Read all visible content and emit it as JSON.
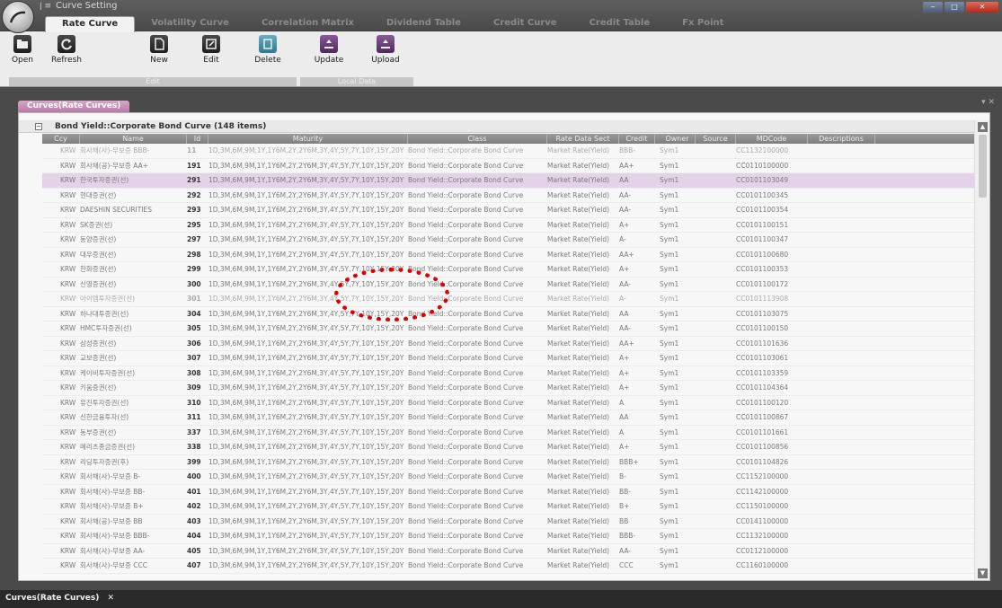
{
  "window": {
    "title": "Curve Setting",
    "qat": "ǀ  ≡",
    "controls": [
      "‒",
      "□",
      "✕"
    ]
  },
  "tabs": [
    "Rate Curve",
    "Volatility Curve",
    "Correlation Matrix",
    "Dividend Table",
    "Credit Curve",
    "Credit Table",
    "Fx Point"
  ],
  "ribbon": {
    "buttons": [
      {
        "label": "Open",
        "icon": "folder-icon"
      },
      {
        "label": "Refresh",
        "icon": "refresh-icon"
      },
      {
        "label": "New",
        "icon": "new-document-icon"
      },
      {
        "label": "Edit",
        "icon": "edit-icon"
      },
      {
        "label": "Delete",
        "icon": "delete-icon"
      },
      {
        "label": "Update",
        "icon": "update-icon"
      },
      {
        "label": "Upload",
        "icon": "upload-icon"
      }
    ],
    "groups": [
      "Edit",
      "Local Data"
    ]
  },
  "document_tab": "Curves(Rate Curves)",
  "group_title": "Bond Yield::Corporate Bond Curve (148 items)",
  "columns": [
    "Ccy",
    "Name",
    "Id",
    "Maturity",
    "Class",
    "Rate Data Sect",
    "Credit",
    "Owner",
    "Source",
    "MDCode",
    "Descriptions"
  ],
  "maturity": "1D,3M,6M,9M,1Y,1Y6M,2Y,2Y6M,3Y,4Y,5Y,7Y,10Y,15Y,20Y",
  "class": "Bond Yield::Corporate Bond Curve",
  "rate_sect": "Market Rate(Yield)",
  "rows": [
    {
      "ccy": "KRW",
      "name": "회사채(사)-무보증 BBB-",
      "id": "11",
      "credit": "BBB-",
      "owner": "Sym1",
      "md": "CC1132100000",
      "partial": true
    },
    {
      "ccy": "KRW",
      "name": "회사채(공)-무보증 AA+",
      "id": "191",
      "credit": "AA+",
      "owner": "Sym1",
      "md": "CC0110100000"
    },
    {
      "ccy": "KRW",
      "name": "한국투자증권(선)",
      "id": "291",
      "credit": "AA",
      "owner": "Sym1",
      "md": "CC0101103049",
      "selected": true
    },
    {
      "ccy": "KRW",
      "name": "현대증권(선)",
      "id": "292",
      "credit": "AA-",
      "owner": "Sym1",
      "md": "CC0101100345"
    },
    {
      "ccy": "KRW",
      "name": "DAESHIN SECURITIES",
      "id": "293",
      "credit": "AA-",
      "owner": "Sym1",
      "md": "CC0101100354"
    },
    {
      "ccy": "KRW",
      "name": "SK증권(선)",
      "id": "295",
      "credit": "A+",
      "owner": "Sym1",
      "md": "CC0101100151"
    },
    {
      "ccy": "KRW",
      "name": "동양증권(선)",
      "id": "297",
      "credit": "A-",
      "owner": "Sym1",
      "md": "CC0101100347"
    },
    {
      "ccy": "KRW",
      "name": "대우증권(선)",
      "id": "298",
      "credit": "AA+",
      "owner": "Sym1",
      "md": "CC0101100680"
    },
    {
      "ccy": "KRW",
      "name": "한화증권(선)",
      "id": "299",
      "credit": "A+",
      "owner": "Sym1",
      "md": "CC0101100353"
    },
    {
      "ccy": "KRW",
      "name": "신영증권(선)",
      "id": "300",
      "credit": "AA-",
      "owner": "Sym1",
      "md": "CC0101100172"
    },
    {
      "ccy": "KRW",
      "name": "아이엠투자증권(선)",
      "id": "301",
      "credit": "A-",
      "owner": "Sym1",
      "md": "CC0101113908",
      "partial": true
    },
    {
      "ccy": "KRW",
      "name": "하나대투증권(선)",
      "id": "304",
      "credit": "AA",
      "owner": "Sym1",
      "md": "CC0101103075"
    },
    {
      "ccy": "KRW",
      "name": "HMC투자증권(선)",
      "id": "305",
      "credit": "AA-",
      "owner": "Sym1",
      "md": "CC0101100150"
    },
    {
      "ccy": "KRW",
      "name": "삼성증권(선)",
      "id": "306",
      "credit": "AA+",
      "owner": "Sym1",
      "md": "CC0101101636"
    },
    {
      "ccy": "KRW",
      "name": "교보증권(선)",
      "id": "307",
      "credit": "A+",
      "owner": "Sym1",
      "md": "CC0101103061"
    },
    {
      "ccy": "KRW",
      "name": "케이비투자증권(선)",
      "id": "308",
      "credit": "A+",
      "owner": "Sym1",
      "md": "CC0101103359"
    },
    {
      "ccy": "KRW",
      "name": "키움증권(선)",
      "id": "309",
      "credit": "A+",
      "owner": "Sym1",
      "md": "CC0101104364"
    },
    {
      "ccy": "KRW",
      "name": "유진투자증권(선)",
      "id": "310",
      "credit": "A",
      "owner": "Sym1",
      "md": "CC0101100120"
    },
    {
      "ccy": "KRW",
      "name": "신한금융투자(선)",
      "id": "311",
      "credit": "AA",
      "owner": "Sym1",
      "md": "CC0101100867"
    },
    {
      "ccy": "KRW",
      "name": "동부증권(선)",
      "id": "337",
      "credit": "A",
      "owner": "Sym1",
      "md": "CC0101101661"
    },
    {
      "ccy": "KRW",
      "name": "메리츠종금증권(선)",
      "id": "338",
      "credit": "A+",
      "owner": "Sym1",
      "md": "CC0101100856"
    },
    {
      "ccy": "KRW",
      "name": "리딩투자증권(후)",
      "id": "399",
      "credit": "BBB+",
      "owner": "Sym1",
      "md": "CC0101104826"
    },
    {
      "ccy": "KRW",
      "name": "회사채(사)-무보증 B-",
      "id": "400",
      "credit": "B-",
      "owner": "Sym1",
      "md": "CC1152100000"
    },
    {
      "ccy": "KRW",
      "name": "회사채(사)-무보증 BB-",
      "id": "401",
      "credit": "BB-",
      "owner": "Sym1",
      "md": "CC1142100000"
    },
    {
      "ccy": "KRW",
      "name": "회사채(사)-무보증 B+",
      "id": "402",
      "credit": "B+",
      "owner": "Sym1",
      "md": "CC1150100000"
    },
    {
      "ccy": "KRW",
      "name": "회사채(공)-무보증 BB",
      "id": "403",
      "credit": "BB",
      "owner": "Sym1",
      "md": "CC0141100000"
    },
    {
      "ccy": "KRW",
      "name": "회사채(사)-무보증 BBB-",
      "id": "404",
      "credit": "BBB-",
      "owner": "Sym1",
      "md": "CC1132100000"
    },
    {
      "ccy": "KRW",
      "name": "회사채(사)-무보증 AA-",
      "id": "405",
      "credit": "AA-",
      "owner": "Sym1",
      "md": "CC0112100000"
    },
    {
      "ccy": "KRW",
      "name": "회사채(사)-무보증 CCC",
      "id": "407",
      "credit": "CCC",
      "owner": "Sym1",
      "md": "CC1160100000"
    }
  ],
  "status_tab": "Curves(Rate Curves)",
  "status_close": "✕",
  "scroll_up": "▲",
  "scroll_down": "▼",
  "collapse": "−",
  "panel_pin": "▾ ✕",
  "colors": {
    "accent": "#b87aa8",
    "selected_row": "#e4d2e8",
    "annotation": "#e00000"
  }
}
